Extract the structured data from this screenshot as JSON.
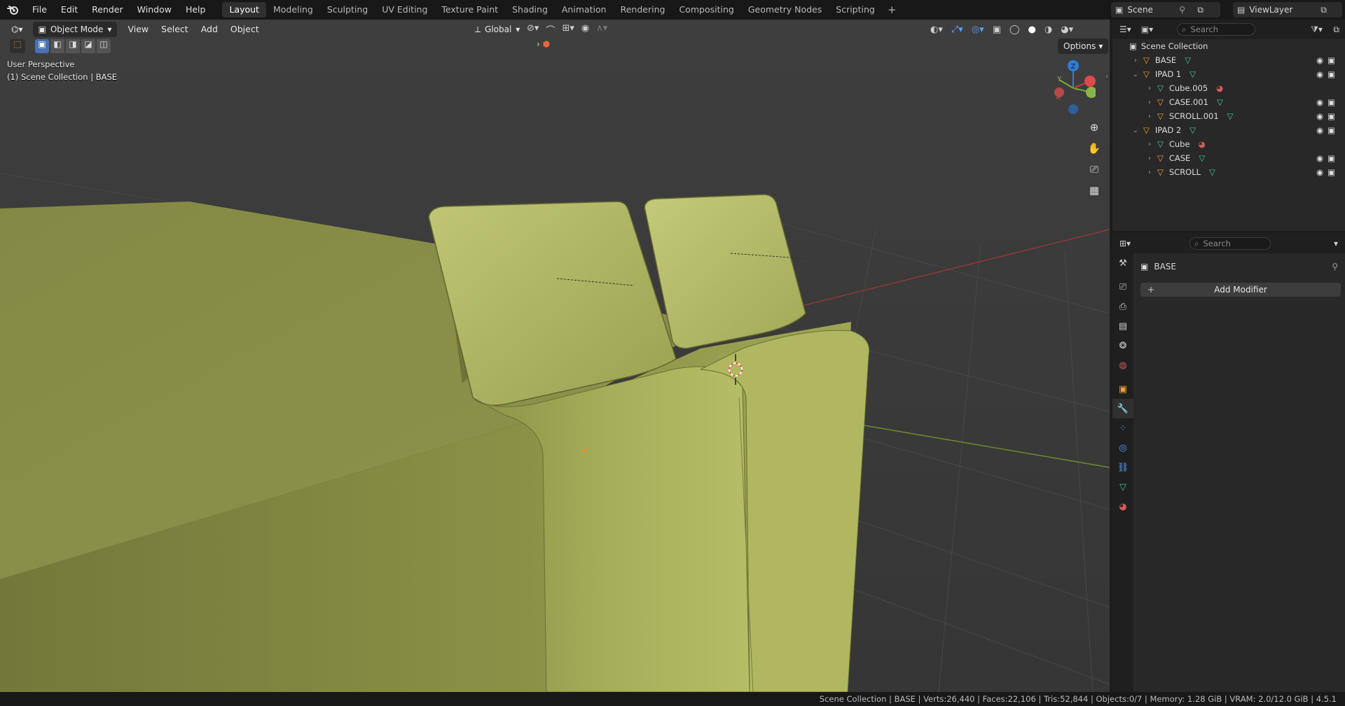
{
  "topbar": {
    "menus": [
      "File",
      "Edit",
      "Render",
      "Window",
      "Help"
    ],
    "workspaces": [
      "Layout",
      "Modeling",
      "Sculpting",
      "UV Editing",
      "Texture Paint",
      "Shading",
      "Animation",
      "Rendering",
      "Compositing",
      "Geometry Nodes",
      "Scripting"
    ],
    "active_workspace": "Layout",
    "scene_name": "Scene",
    "view_layer": "ViewLayer"
  },
  "viewport": {
    "mode": "Object Mode",
    "menus": [
      "View",
      "Select",
      "Add",
      "Object"
    ],
    "transform_orientation": "Global",
    "options_label": "Options",
    "perspective_label": "User Perspective",
    "collection_label": "(1) Scene Collection | BASE",
    "gizmo_axes": [
      "Z",
      "Y",
      "X"
    ],
    "object_color": "#a6ad57"
  },
  "outliner": {
    "search_placeholder": "Search",
    "root": "Scene Collection",
    "items": [
      {
        "name": "BASE",
        "type": "empty",
        "level": 0,
        "expanded": false,
        "visible": true
      },
      {
        "name": "IPAD 1",
        "type": "empty",
        "level": 0,
        "expanded": true,
        "visible": true
      },
      {
        "name": "Cube.005",
        "type": "mesh",
        "level": 1,
        "expanded": false,
        "visible": false
      },
      {
        "name": "CASE.001",
        "type": "empty",
        "level": 1,
        "expanded": false,
        "visible": true
      },
      {
        "name": "SCROLL.001",
        "type": "empty",
        "level": 1,
        "expanded": false,
        "visible": true
      },
      {
        "name": "IPAD 2",
        "type": "empty",
        "level": 0,
        "expanded": true,
        "visible": true
      },
      {
        "name": "Cube",
        "type": "mesh",
        "level": 1,
        "expanded": false,
        "visible": false
      },
      {
        "name": "CASE",
        "type": "empty",
        "level": 1,
        "expanded": false,
        "visible": true
      },
      {
        "name": "SCROLL",
        "type": "empty",
        "level": 1,
        "expanded": false,
        "visible": true
      }
    ]
  },
  "properties": {
    "search_placeholder": "Search",
    "object_name": "BASE",
    "add_modifier_label": "Add Modifier",
    "tabs": [
      "tool",
      "render",
      "output",
      "view-layer",
      "scene",
      "world",
      "object",
      "modifiers",
      "particles",
      "physics",
      "constraints",
      "data",
      "material"
    ],
    "active_tab": "modifiers"
  },
  "statusbar": {
    "text": "Scene Collection | BASE | Verts:26,440 | Faces:22,106 | Tris:52,844 | Objects:0/7 | Memory: 1.28 GiB | VRAM: 2.0/12.0 GiB | 4.5.1"
  }
}
